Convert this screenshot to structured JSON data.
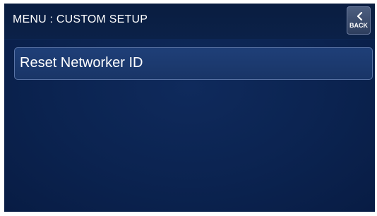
{
  "header": {
    "title": "MENU : CUSTOM SETUP",
    "back_label": "BACK",
    "back_icon": "chevron-left-icon"
  },
  "menu": {
    "items": [
      {
        "label": "Reset Networker ID"
      }
    ]
  },
  "colors": {
    "background": "#0b2350",
    "header": "#0a1d40",
    "item_fill": "#1f3f78",
    "item_border": "#5a74a6",
    "text": "#ffffff"
  }
}
